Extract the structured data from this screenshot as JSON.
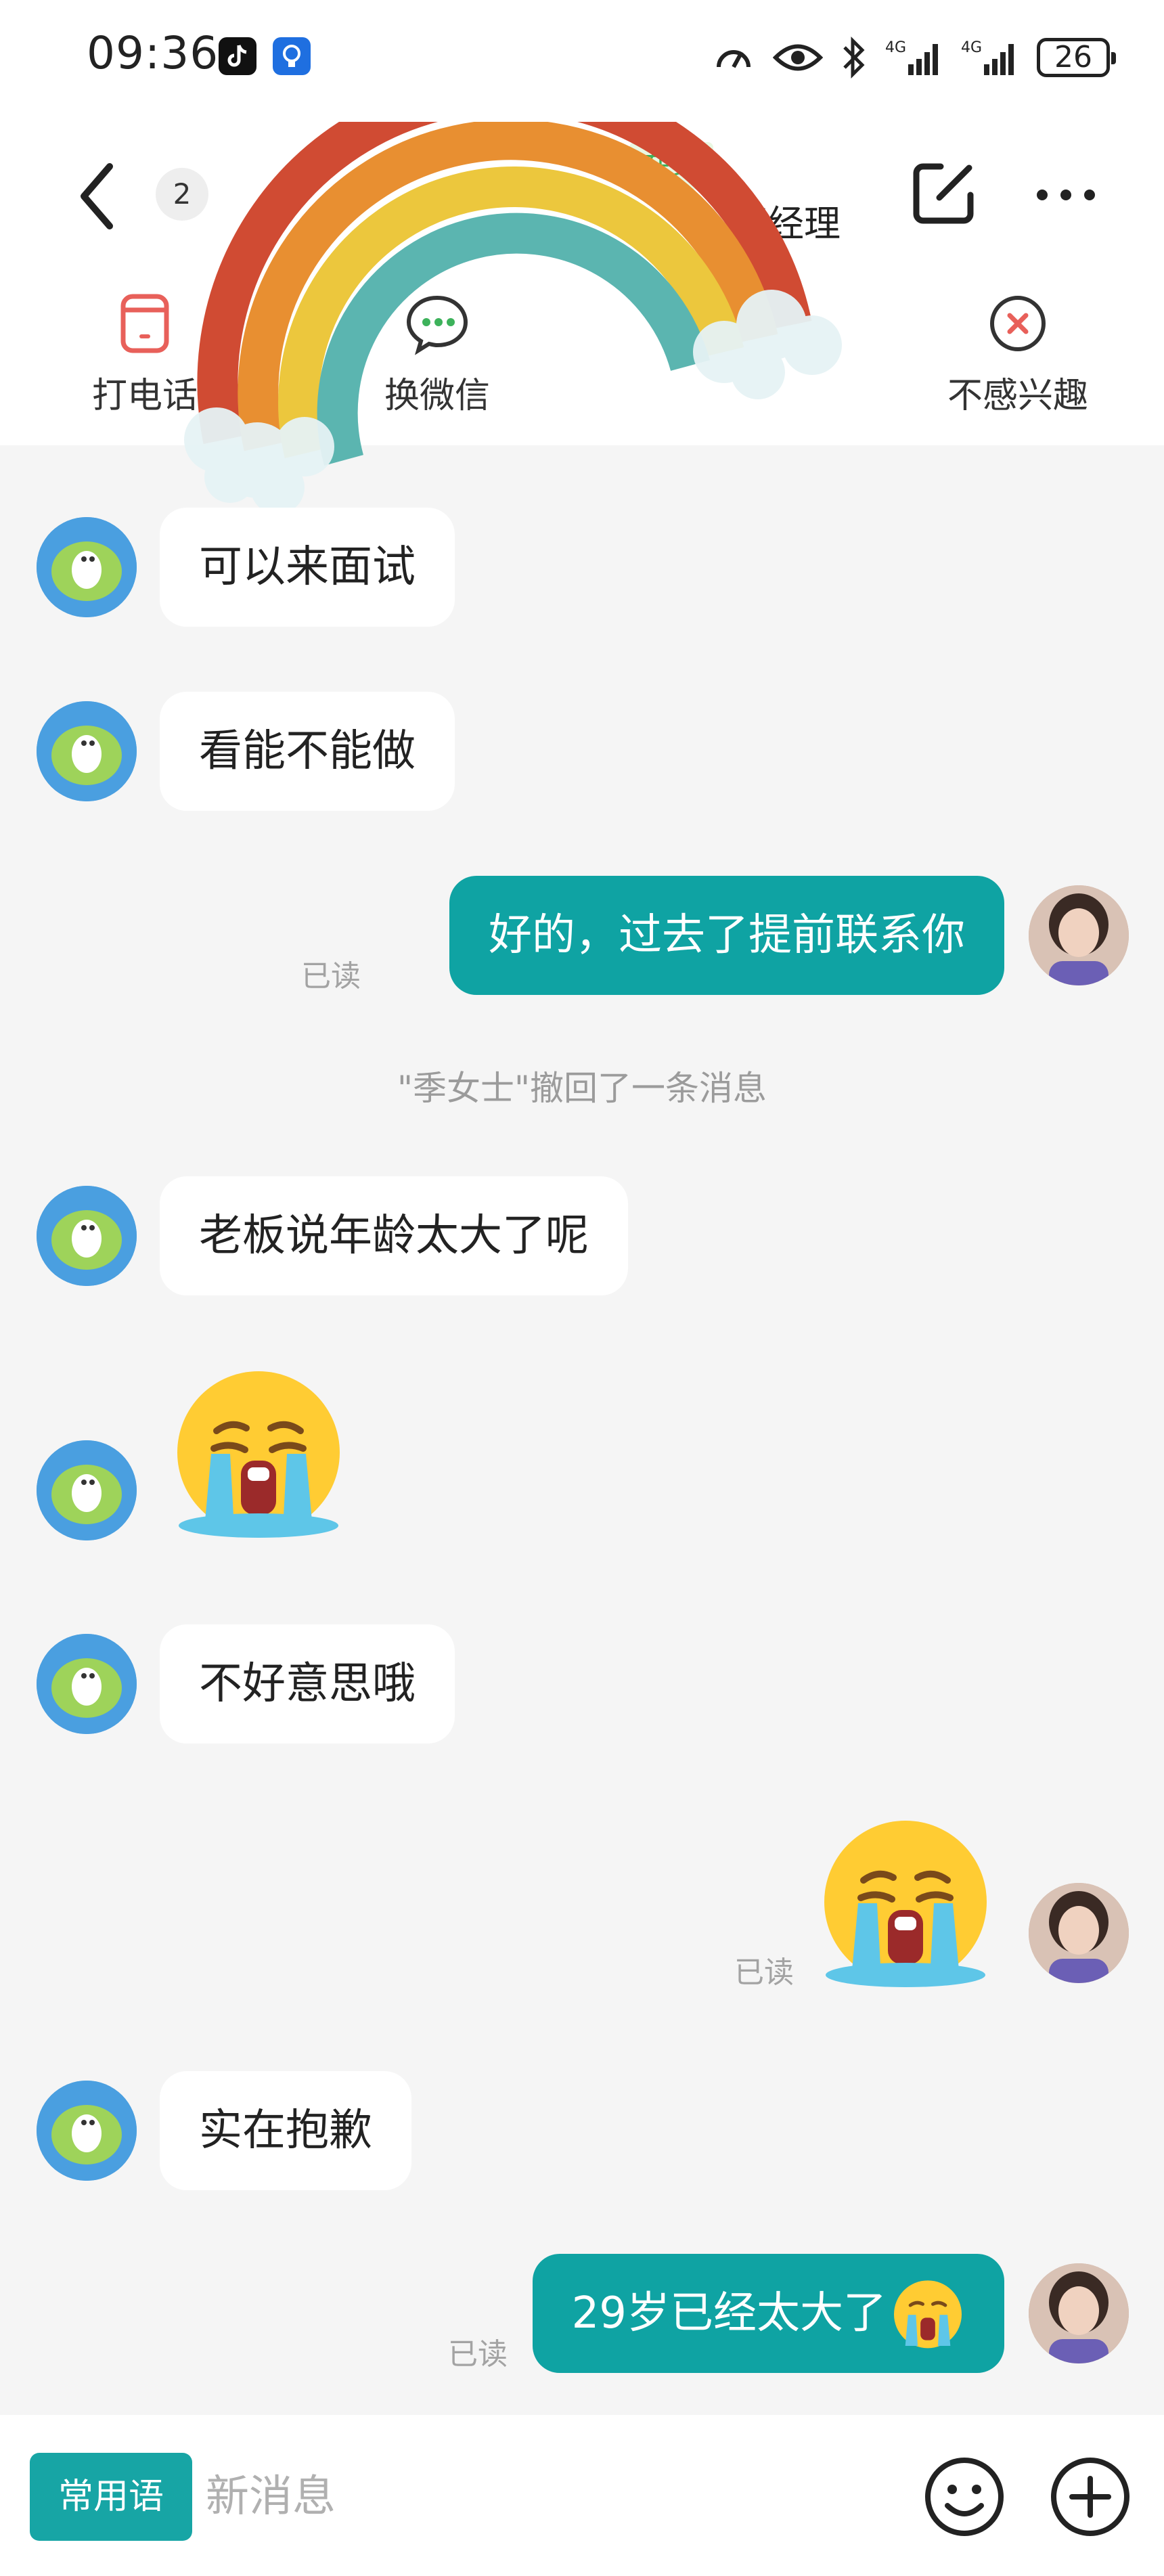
{
  "status_bar": {
    "time": "09:36",
    "battery": "26",
    "network_1": "4G",
    "network_2": "4G"
  },
  "header": {
    "unread_count": "2",
    "online_status": "在线",
    "title_fragment": "事经理"
  },
  "actions": [
    {
      "label": "打电话",
      "icon": "phone-icon"
    },
    {
      "label": "换微信",
      "icon": "wechat-icon"
    },
    {
      "label": "",
      "icon": "resume-icon"
    },
    {
      "label": "不感兴趣",
      "icon": "close-circle-icon"
    }
  ],
  "messages": [
    {
      "side": "in",
      "type": "text",
      "text": "可以来面试"
    },
    {
      "side": "in",
      "type": "text",
      "text": "看能不能做"
    },
    {
      "side": "out",
      "type": "text",
      "text": "好的，过去了提前联系你",
      "status": "已读"
    },
    {
      "type": "system",
      "text": "\"季女士\"撤回了一条消息"
    },
    {
      "side": "in",
      "type": "text",
      "text": "老板说年龄太大了呢"
    },
    {
      "side": "in",
      "type": "emoji",
      "emoji": "loudly-crying-emoji"
    },
    {
      "side": "in",
      "type": "text",
      "text": "不好意思哦"
    },
    {
      "side": "out",
      "type": "emoji",
      "emoji": "loudly-crying-emoji",
      "status": "已读"
    },
    {
      "side": "in",
      "type": "text",
      "text": "实在抱歉"
    },
    {
      "side": "out",
      "type": "text",
      "text": "29岁已经太大了",
      "emoji": "loudly-crying-emoji",
      "status": "已读"
    }
  ],
  "input_bar": {
    "phrases_label": "常用语",
    "placeholder": "新消息"
  },
  "colors": {
    "outgoing_bubble": "#0fa3a3",
    "incoming_bubble": "#ffffff",
    "background": "#f5f5f5",
    "accent": "#17a5a5",
    "online_green": "#3db25b"
  }
}
